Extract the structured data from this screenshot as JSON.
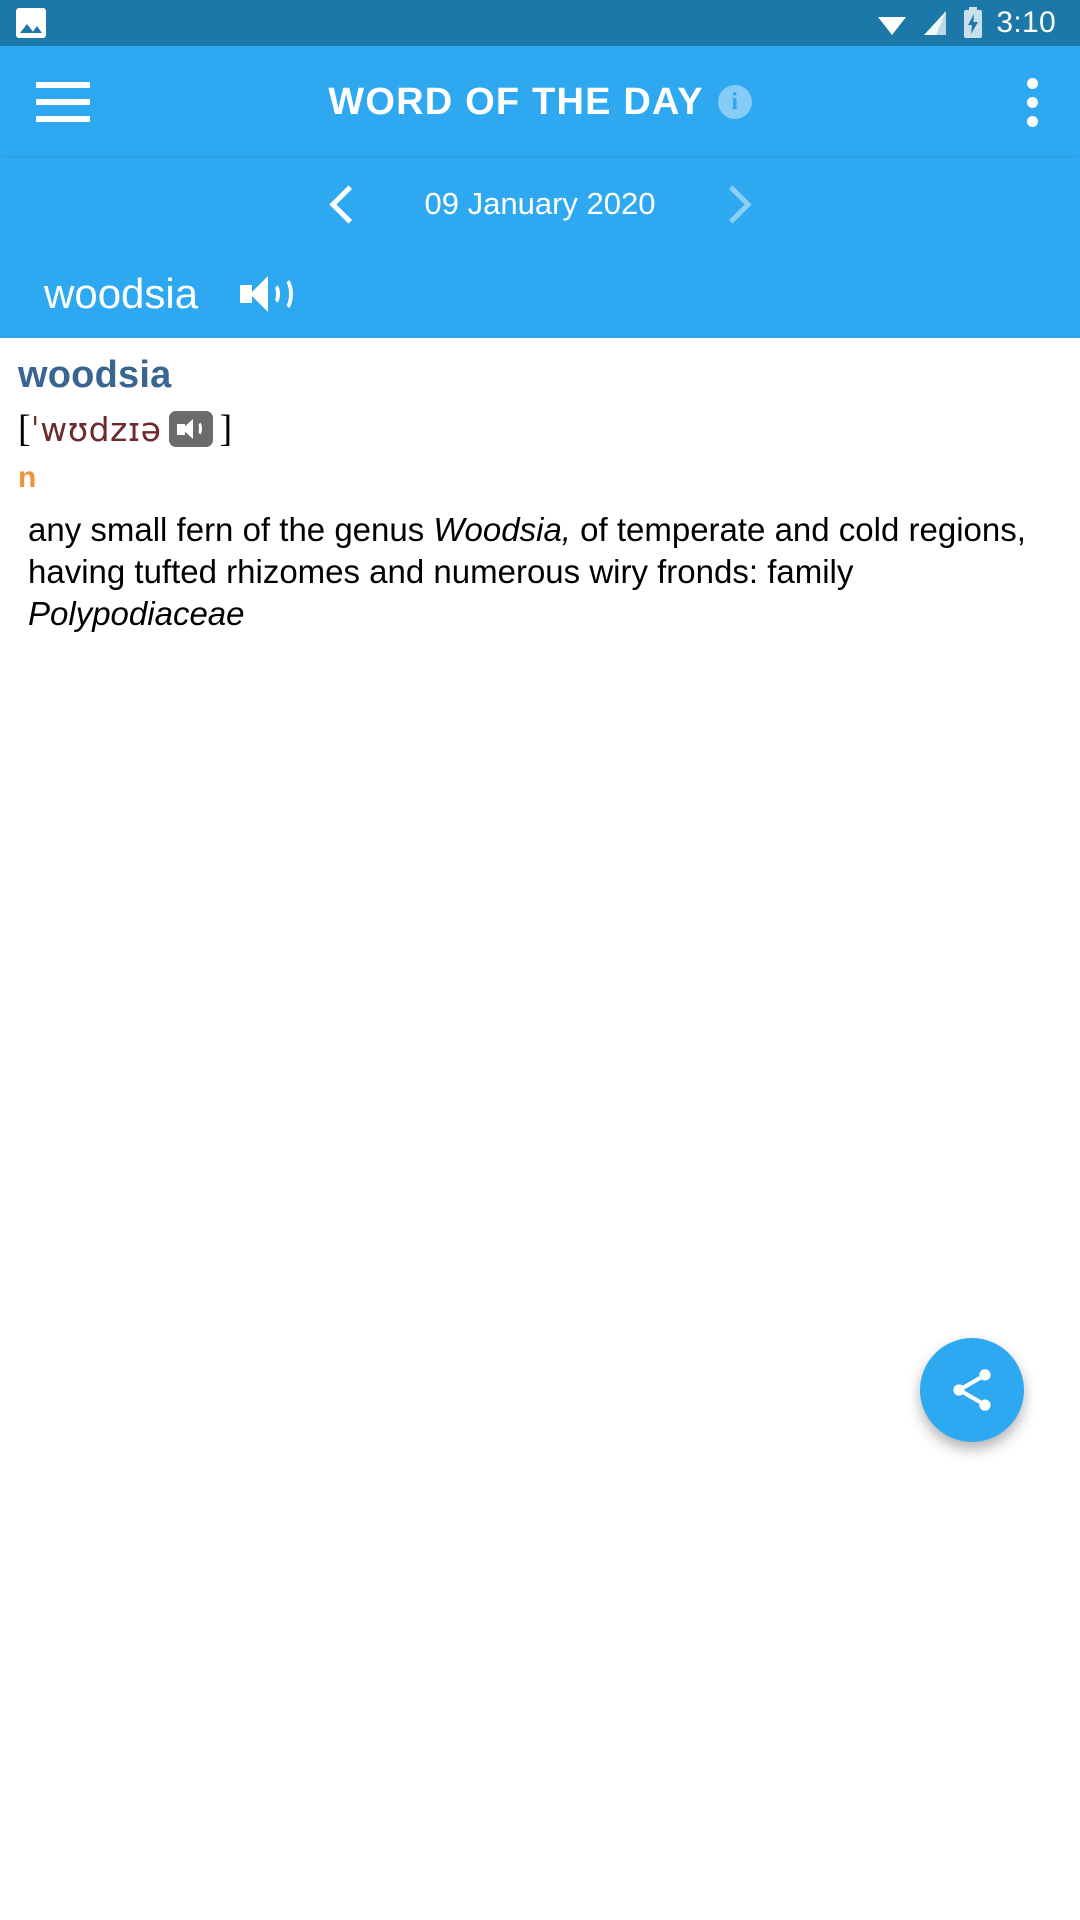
{
  "status_bar": {
    "time": "3:10",
    "icons": [
      "gallery-icon",
      "wifi-icon",
      "signal-icon",
      "battery-charging-icon"
    ],
    "background_color": "#1c78a8"
  },
  "app_bar": {
    "menu_icon": "hamburger-menu-icon",
    "title": "WORD OF THE DAY",
    "info_icon_label": "i",
    "overflow_icon": "more-vert-icon",
    "background_color": "#2ea8f0"
  },
  "date_nav": {
    "prev_label": "‹",
    "date": "09 January 2020",
    "next_label": "›",
    "next_disabled": true
  },
  "header": {
    "word": "woodsia",
    "speaker_icon": "volume-up-icon"
  },
  "entry": {
    "headword": "woodsia",
    "headword_color": "#3a6591",
    "pronunciation_open": "[",
    "pronunciation": "ˈwʊdzɪə",
    "pronunciation_close": "]",
    "pronunciation_color": "#6d2a2a",
    "speaker_button_icon": "volume-up-icon",
    "part_of_speech": "n",
    "part_of_speech_color": "#f0943c",
    "definition_part1": "any small fern of the genus ",
    "definition_italic1": "Woodsia,",
    "definition_part2": " of temperate and cold regions, having tufted rhizomes and numerous wiry fronds: family ",
    "definition_italic2": "Polypodiaceae"
  },
  "fab": {
    "icon": "share-icon",
    "color": "#2ea8f0"
  }
}
